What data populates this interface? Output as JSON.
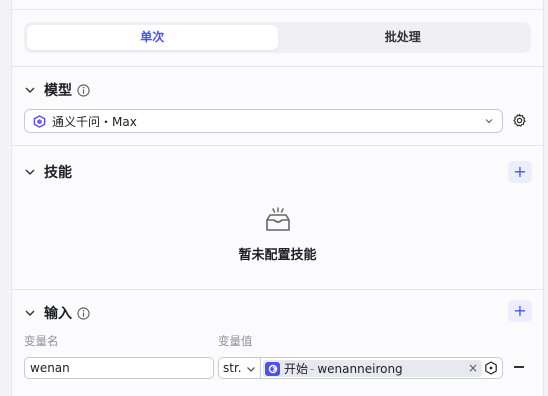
{
  "mode_tabs": {
    "single": "单次",
    "batch": "批处理"
  },
  "model_section": {
    "title": "模型",
    "selected_model": "通义千问・Max"
  },
  "skills_section": {
    "title": "技能",
    "add_label": "+",
    "empty_text": "暂未配置技能"
  },
  "input_section": {
    "title": "输入",
    "add_label": "+",
    "col_name": "变量名",
    "col_value": "变量值",
    "row": {
      "name": "wenan",
      "type": "str.",
      "ref_node": "开始",
      "ref_sep": "-",
      "ref_var": "wenanneirong",
      "clear": "×"
    }
  },
  "colors": {
    "accent": "#4d53e8",
    "chip_bg": "#e8e9ef",
    "add_bg": "#eceefd"
  },
  "icons": [
    "chevron-down-icon",
    "info-icon",
    "model-logo-icon",
    "settings-gear-icon",
    "plus-icon",
    "empty-box-icon",
    "node-start-icon",
    "variable-icon",
    "minus-icon"
  ]
}
